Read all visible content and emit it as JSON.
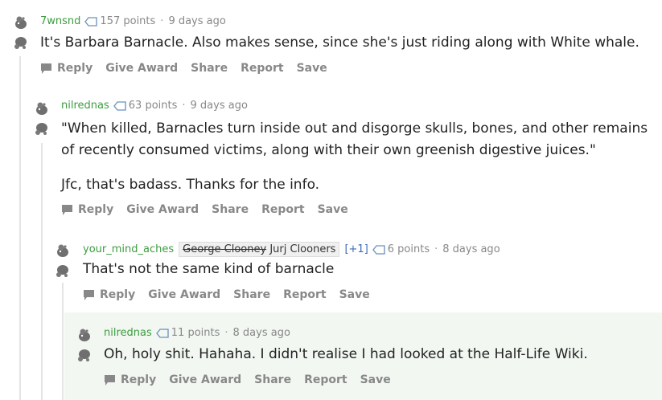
{
  "comments": [
    {
      "username": "7wnsnd",
      "points": "157 points",
      "age": "9 days ago",
      "body": [
        "It's Barbara Barnacle. Also makes sense, since she's just riding along with White whale."
      ]
    },
    {
      "username": "nilrednas",
      "points": "63 points",
      "age": "9 days ago",
      "body": [
        "\"When killed, Barnacles turn inside out and disgorge skulls, bones, and other remains of recently consumed victims, along with their own greenish digestive juices.\"",
        "Jfc, that's badass. Thanks for the info."
      ]
    },
    {
      "username": "your_mind_aches",
      "flair_strike": "George Clooney",
      "flair_text": "Jurj Clooners",
      "flair_plus": "[+1]",
      "points": "6 points",
      "age": "8 days ago",
      "body": [
        "That's not the same kind of barnacle"
      ]
    },
    {
      "username": "nilrednas",
      "points": "11 points",
      "age": "8 days ago",
      "body": [
        "Oh, holy shit. Hahaha. I didn't realise I had looked at the Half-Life Wiki."
      ]
    }
  ],
  "actions": {
    "reply": "Reply",
    "give_award": "Give Award",
    "share": "Share",
    "report": "Report",
    "save": "Save"
  },
  "separator": "·",
  "icons": {
    "upvote": "snoo-upvote-icon",
    "downvote": "snoo-downvote-icon",
    "reply": "speech-bubble-icon",
    "points": "tag-icon"
  },
  "colors": {
    "username": "#3d9c40",
    "meta": "#888888",
    "highlight": "#f2f7f2",
    "plus": "#3c6bbd"
  }
}
